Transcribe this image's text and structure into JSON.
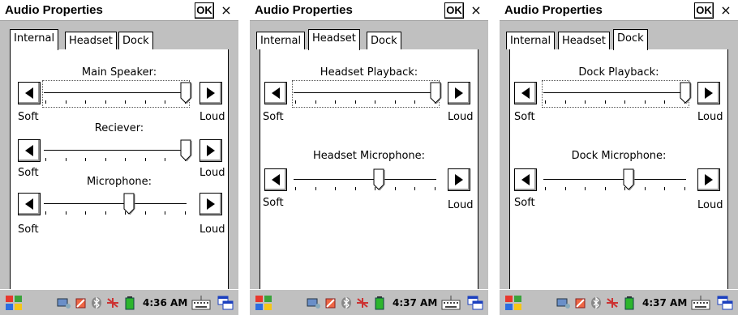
{
  "screens": [
    {
      "title": "Audio Properties",
      "ok_label": "OK",
      "close_label": "×",
      "tabs": [
        "Internal",
        "Headset",
        "Dock"
      ],
      "active_tab": 0,
      "sliders": [
        {
          "label": "Main Speaker:",
          "soft": "Soft",
          "loud": "Loud",
          "level": 1.0,
          "focused": true
        },
        {
          "label": "Reciever:",
          "soft": "Soft",
          "loud": "Loud",
          "level": 1.0,
          "focused": false
        },
        {
          "label": "Microphone:",
          "soft": "Soft",
          "loud": "Loud",
          "level": 0.6,
          "focused": false
        }
      ],
      "clock": "4:36 AM"
    },
    {
      "title": "Audio Properties",
      "ok_label": "OK",
      "close_label": "×",
      "tabs": [
        "Internal",
        "Headset",
        "Dock"
      ],
      "active_tab": 1,
      "sliders": [
        {
          "label": "Headset Playback:",
          "soft": "Soft",
          "loud": "Loud",
          "level": 1.0,
          "focused": true
        },
        {
          "label": "Headset Microphone:",
          "soft": "Soft",
          "loud": "Loud",
          "level": 0.6,
          "focused": false
        }
      ],
      "clock": "4:37 AM"
    },
    {
      "title": "Audio Properties",
      "ok_label": "OK",
      "close_label": "×",
      "tabs": [
        "Internal",
        "Headset",
        "Dock"
      ],
      "active_tab": 2,
      "sliders": [
        {
          "label": "Dock Playback:",
          "soft": "Soft",
          "loud": "Loud",
          "level": 1.0,
          "focused": true
        },
        {
          "label": "Dock Microphone:",
          "soft": "Soft",
          "loud": "Loud",
          "level": 0.6,
          "focused": false
        }
      ],
      "clock": "4:37 AM"
    }
  ],
  "icons": {
    "start": "windows-start-icon",
    "tray": [
      "network-icon",
      "battery-warning-icon",
      "bluetooth-icon",
      "wireless-off-icon",
      "battery-icon"
    ],
    "keyboard": "keyboard-icon",
    "window": "window-switch-icon"
  }
}
